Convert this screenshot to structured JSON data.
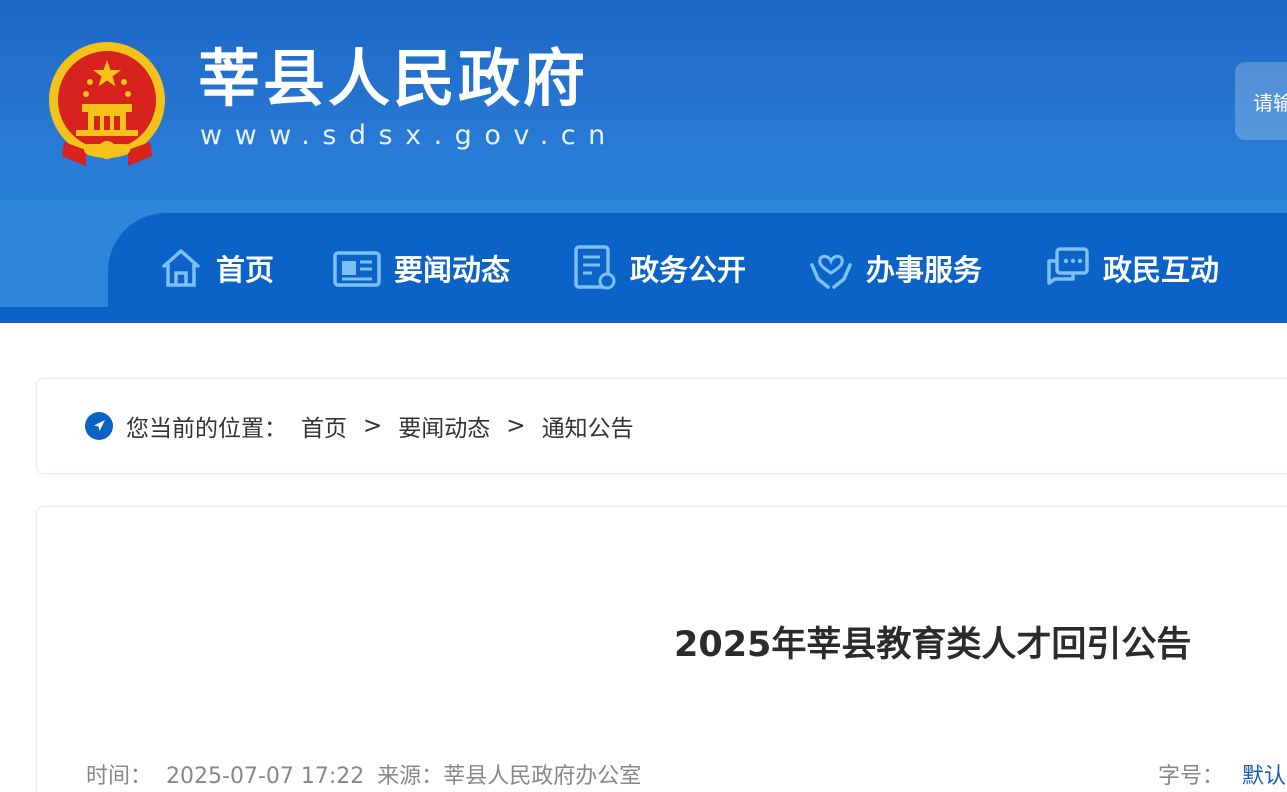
{
  "header": {
    "title": "莘县人民政府",
    "url": "www.sdsx.gov.cn",
    "search_placeholder": "请输"
  },
  "nav": {
    "items": [
      {
        "label": "首页",
        "icon": "home-icon"
      },
      {
        "label": "要闻动态",
        "icon": "news-icon"
      },
      {
        "label": "政务公开",
        "icon": "document-icon"
      },
      {
        "label": "办事服务",
        "icon": "service-hands-icon"
      },
      {
        "label": "政民互动",
        "icon": "chat-icon"
      }
    ]
  },
  "breadcrumb": {
    "prefix": "您当前的位置：",
    "items": [
      "首页",
      "要闻动态",
      "通知公告"
    ],
    "separator": ">"
  },
  "article": {
    "title": "2025年莘县教育类人才回引公告",
    "time_label": "时间：",
    "time_value": "2025-07-07 17:22",
    "source_label": "来源：",
    "source_value": "莘县人民政府办公室",
    "font_size_label": "字号：",
    "font_size_default": "默认"
  },
  "colors": {
    "header_blue": "#1e67c6",
    "nav_blue": "#0b63c8",
    "link_blue": "#1a5fb4",
    "emblem_red": "#d8221d",
    "emblem_gold": "#f3c21b"
  }
}
